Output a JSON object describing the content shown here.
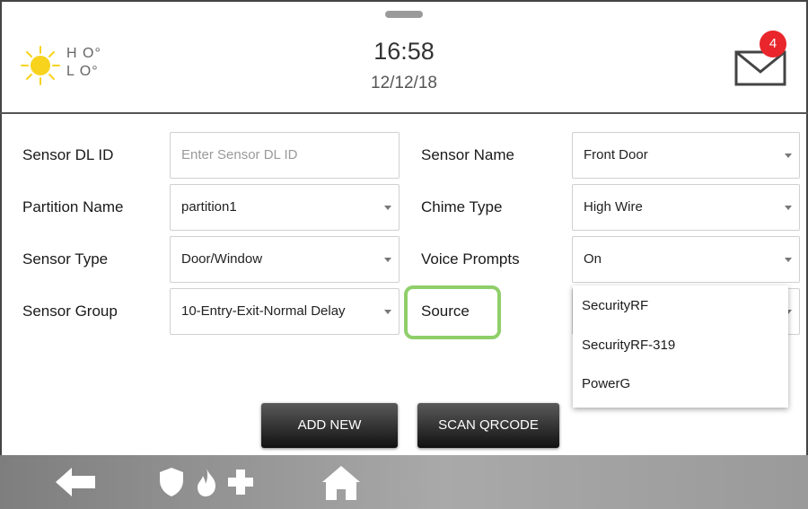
{
  "header": {
    "weather": {
      "icon": "sun-icon",
      "high": "H O°",
      "low": "L O°"
    },
    "time": "16:58",
    "date": "12/12/18",
    "mail": {
      "icon": "mail-icon",
      "badge_count": "4"
    }
  },
  "form": {
    "sensor_dl_id": {
      "label": "Sensor DL ID",
      "value": "",
      "placeholder": "Enter Sensor DL ID"
    },
    "partition_name": {
      "label": "Partition Name",
      "value": "partition1"
    },
    "sensor_type": {
      "label": "Sensor Type",
      "value": "Door/Window"
    },
    "sensor_group": {
      "label": "Sensor Group",
      "value": "10-Entry-Exit-Normal Delay"
    },
    "sensor_name": {
      "label": "Sensor Name",
      "value": "Front Door"
    },
    "chime_type": {
      "label": "Chime Type",
      "value": "High Wire"
    },
    "voice_prompts": {
      "label": "Voice Prompts",
      "value": "On"
    },
    "source": {
      "label": "Source",
      "options": [
        "SecurityRF",
        "SecurityRF-319",
        "PowerG"
      ]
    }
  },
  "buttons": {
    "add_new": "ADD NEW",
    "scan_qrcode": "SCAN QRCODE"
  },
  "footer": {
    "icons": [
      "back-arrow-icon",
      "shield-icon",
      "fire-icon",
      "medical-cross-icon",
      "home-icon"
    ]
  },
  "colors": {
    "badge": "#e8262b",
    "highlight": "#8fcf6a",
    "sun": "#f7d31e"
  }
}
